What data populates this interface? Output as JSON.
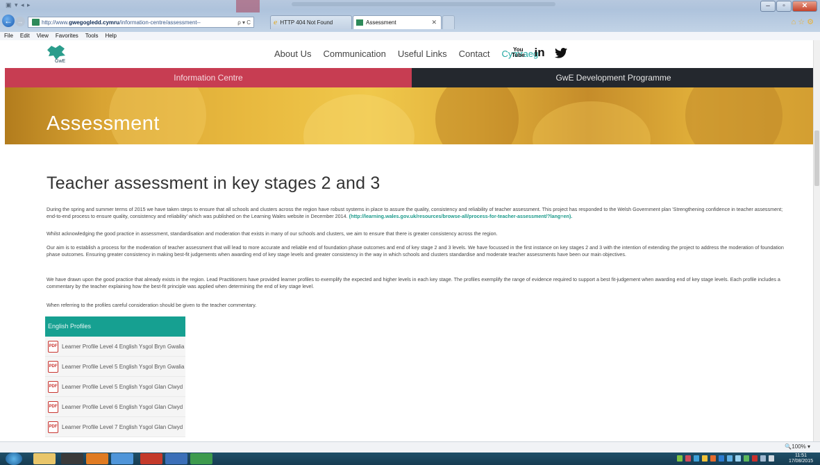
{
  "browser": {
    "url_prefix": "http://www.",
    "url_domain": "gwegogledd.cymru",
    "url_suffix": "/information-centre/assessment--",
    "address_tools": "ρ ▾ C",
    "tabs": [
      {
        "label": "HTTP 404 Not Found"
      },
      {
        "label": "Assessment"
      }
    ],
    "menu": [
      "File",
      "Edit",
      "View",
      "Favorites",
      "Tools",
      "Help"
    ],
    "zoom": "🔍100%  ▾"
  },
  "site": {
    "nav": [
      "About Us",
      "Communication",
      "Useful Links",
      "Contact",
      "Cymraeg"
    ],
    "social": {
      "youtube": "You\nTube",
      "linkedin": "in",
      "twitter": "🐦"
    },
    "tabs": {
      "info": "Information Centre",
      "dev": "GwE Development Programme"
    },
    "hero_title": "Assessment",
    "heading": "Teacher assessment in key stages 2 and 3",
    "paragraphs": {
      "p1": "During the spring and summer terms of 2015 we have taken steps to ensure that all schools and clusters across the region have robust systems in place to assure the quality, consistency and reliability of teacher assessment. This project has responded to the Welsh Government plan 'Strengthening confidence in teacher assessment; end-to-end process to ensure quality, consistency and reliability' which was published on the Learning Wales website in December 2014. ",
      "p1_link": "(http://learning.wales.gov.uk/resources/browse-all/process-for-teacher-assessment/?lang=en).",
      "p2": "Whilst acknowledging the good practice in assessment, standardisation and moderation that exists in many of our schools and clusters, we aim to ensure that there is greater consistency across the region.",
      "p3": "Our aim is to establish a process for the moderation of teacher assessment that will lead to more accurate and reliable end of foundation phase outcomes and end of key stage 2 and 3 levels. We have focussed in the first instance on key stages 2 and 3 with the intention of extending the project to address the moderation of foundation phase outcomes. Ensuring greater consistency in making best-fit judgements when awarding end of key stage levels and greater consistency in the way in which schools and clusters standardise and moderate teacher assessments have been our main objectives.",
      "p4": "We have drawn upon the good practice that already exists in the region. Lead Practitioners have provided learner profiles to exemplify the expected and higher levels in each key stage. The profiles exemplify the range of evidence required to support a best fit-judgement when awarding end of key stage levels. Each profile includes a commentary by the teacher explaining how the best-fit principle was applied when determining the end of key stage level.",
      "p5": "When referring to the profiles careful consideration should be given to the teacher commentary."
    },
    "profiles": {
      "header": "English Profiles",
      "pdf_label": "PDF",
      "items": [
        "Learner Profile Level 4 English Ysgol Bryn Gwalia",
        "Learner Profile Level 5 English Ysgol Bryn Gwalia",
        "Learner Profile Level 5 English Ysgol Glan Clwyd",
        "Learner Profile Level 6 English Ysgol Glan Clwyd",
        "Learner Profile Level 7 English Ysgol Glan Clwyd"
      ]
    }
  },
  "taskbar": {
    "time": "11:51",
    "date": "17/08/2015"
  },
  "colors": {
    "info_tab": "#c73d52",
    "dev_tab": "#24282e",
    "accent_teal": "#16a091",
    "welsh_link": "#1fa6a0"
  }
}
